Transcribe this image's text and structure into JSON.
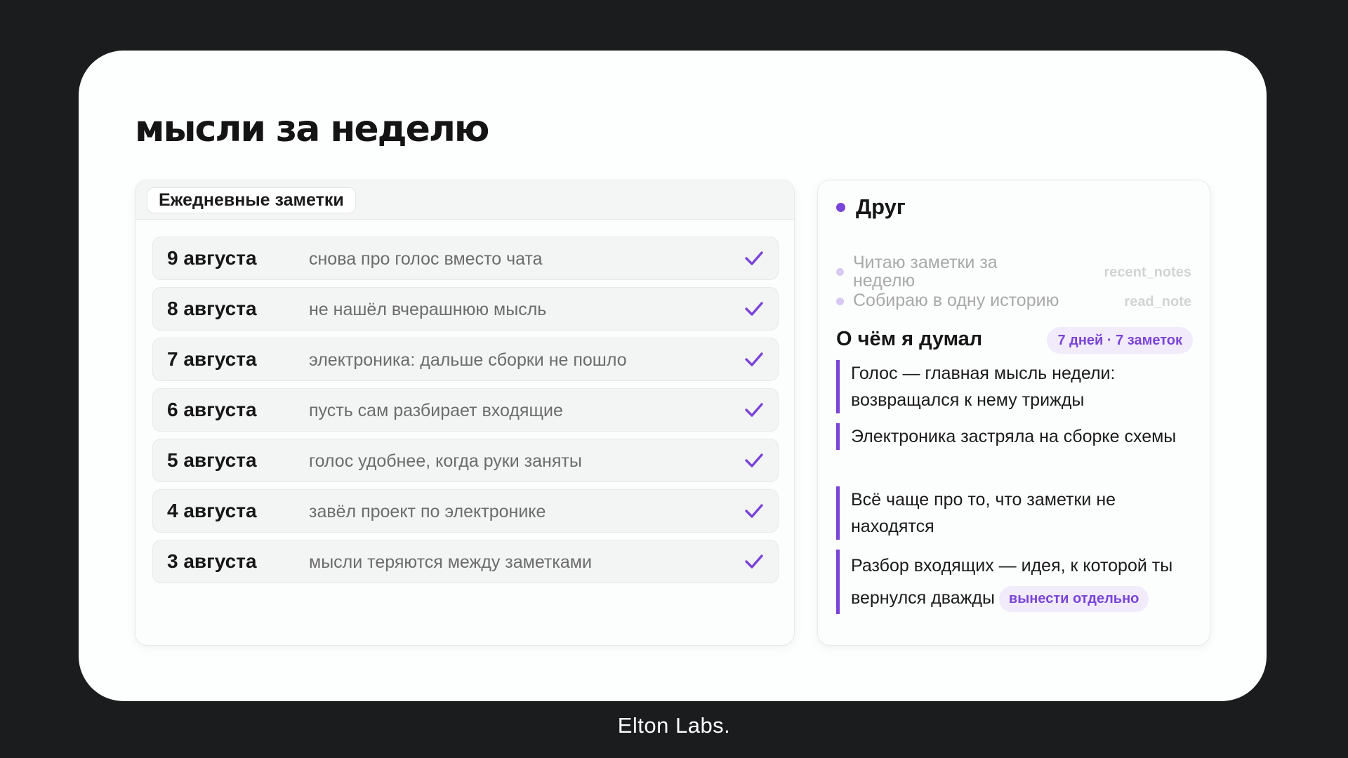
{
  "page": {
    "title": "мысли за неделю"
  },
  "notes": {
    "tab_label": "Ежедневные заметки",
    "items": [
      {
        "date": "9 августа",
        "text": "снова про голос вместо чата",
        "status_icon": "check-icon"
      },
      {
        "date": "8 августа",
        "text": "не нашёл вчерашнюю мысль",
        "status_icon": "check-icon"
      },
      {
        "date": "7 августа",
        "text": "электроника: дальше сборки не пошло",
        "status_icon": "check-icon"
      },
      {
        "date": "6 августа",
        "text": "пусть сам разбирает входящие",
        "status_icon": "check-icon"
      },
      {
        "date": "5 августа",
        "text": "голос удобнее, когда руки заняты",
        "status_icon": "check-icon"
      },
      {
        "date": "4 августа",
        "text": "завёл проект по электронике",
        "status_icon": "check-icon"
      },
      {
        "date": "3 августа",
        "text": "мысли теряются между заметками",
        "status_icon": "check-icon"
      }
    ]
  },
  "friend": {
    "name": "Друг",
    "steps": [
      {
        "text": "Читаю заметки за неделю",
        "tool": "recent_notes"
      },
      {
        "text": "Собираю в одну историю",
        "tool": "read_note"
      }
    ],
    "summary_title": "О чём я думал",
    "summary_badge": "7 дней · 7 заметок",
    "thoughts": [
      {
        "text": "Голос — главная мысль недели: возвращался к нему трижды"
      },
      {
        "text": "Электроника застряла на сборке схемы"
      },
      {
        "text": "Всё чаще про то, что заметки не находятся"
      },
      {
        "text": "Разбор входящих — идея, к которой ты вернулся дважды",
        "tag": "вынести отдельно"
      }
    ]
  },
  "footer": {
    "brand": "Elton Labs."
  },
  "colors": {
    "accent": "#7b44d8",
    "background": "#1a1c1d",
    "card": "#fdfefe",
    "accent_soft": "#f1ebfb"
  }
}
